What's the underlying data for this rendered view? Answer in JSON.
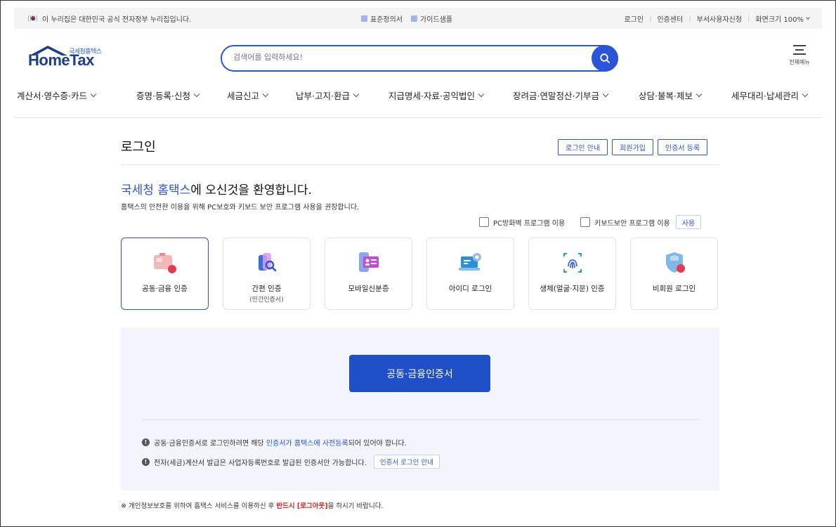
{
  "gov_banner": {
    "text": "이 누리집은 대한민국 공식 전자정부 누리집입니다.",
    "links": [
      "표준정의서",
      "가이드샘플"
    ],
    "right": [
      "로그인",
      "인증센터",
      "부서사용자신청",
      "화면크기 100%"
    ]
  },
  "header": {
    "logo_small": "국세청홈택스",
    "logo_text": "HomeTax",
    "search_placeholder": "검색어를 입력하세요!",
    "allmenu_label": "전체메뉴"
  },
  "gnb": [
    "계산서·영수증·카드",
    "증명·등록·신청",
    "세금신고",
    "납부·고지·환급",
    "지급명세·자료·공익법인",
    "장려금·연말정산·기부금",
    "상담·불복·제보",
    "세무대리·납세관리"
  ],
  "page": {
    "title": "로그인",
    "top_buttons": [
      "로그인 안내",
      "회원가입",
      "인증서 등록"
    ],
    "welcome_blue": "국세청 홈택스",
    "welcome_rest": "에 오신것을 환영합니다.",
    "welcome_sub": "홈택스의 안전한 이용을 위해 PC보호와 키보드 보안 프로그램 사용을 권장합니다.",
    "options": {
      "pc_firewall": "PC방화벽 프로그램 이용",
      "keyboard_security": "키보드보안 프로그램 이용",
      "use_button": "사용"
    }
  },
  "login_methods": [
    {
      "label": "공동·금융 인증",
      "sub": "",
      "icon": "certificate-card-icon",
      "selected": true
    },
    {
      "label": "간편 인증",
      "sub": "(민간인증서)",
      "icon": "simple-auth-phone-icon",
      "selected": false
    },
    {
      "label": "모바일신분증",
      "sub": "",
      "icon": "mobile-id-icon",
      "selected": false
    },
    {
      "label": "아이디 로그인",
      "sub": "",
      "icon": "id-login-laptop-icon",
      "selected": false
    },
    {
      "label": "생체(얼굴·지문) 인증",
      "sub": "",
      "icon": "fingerprint-icon",
      "selected": false
    },
    {
      "label": "비회원 로그인",
      "sub": "",
      "icon": "guest-shield-icon",
      "selected": false
    }
  ],
  "panel": {
    "main_button": "공동·금융인증서",
    "note1_pre": "공동·금융인증서로 로그인하려면 해당 ",
    "note1_blue": "인증서가 홈택스에 사전등록",
    "note1_post": "되어 있어야 합니다.",
    "note2": "전자(세금)계산서 발급은 사업자등록번호로 발급된 인증서만 가능합니다.",
    "note2_button": "인증서 로그인 안내"
  },
  "footer": {
    "pre": "※ 개인정보보호를 위하여 홈택스 서비스를 이용하신 후 ",
    "red": "반드시 [로그아웃]",
    "post": "을 하시기 바랍니다."
  },
  "colors": {
    "primary": "#2b55d8",
    "primary_dark": "#1f50c8",
    "logo": "#1b3c8f",
    "panel_bg": "#f2f5fb",
    "warning": "#d32020"
  }
}
